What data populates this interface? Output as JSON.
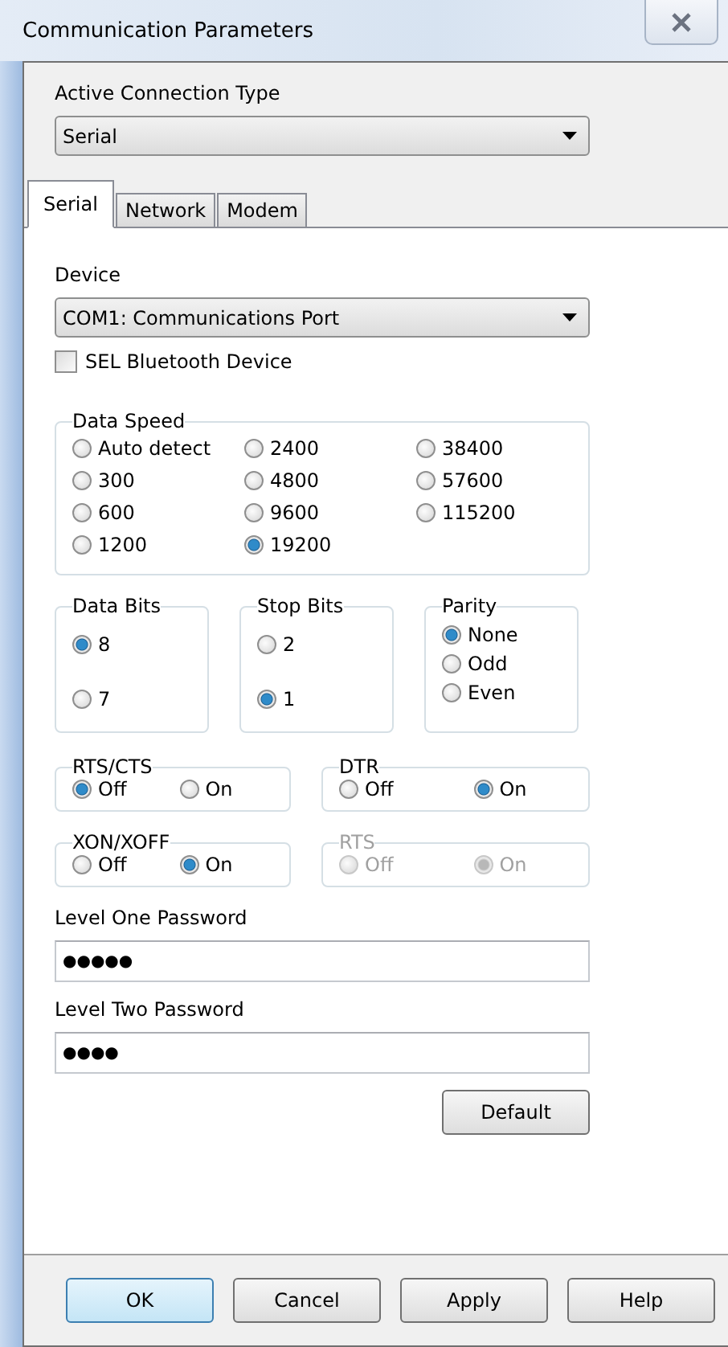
{
  "window": {
    "title": "Communication Parameters"
  },
  "connection": {
    "label": "Active Connection Type",
    "value": "Serial"
  },
  "tabs": [
    {
      "label": "Serial",
      "selected": true
    },
    {
      "label": "Network",
      "selected": false
    },
    {
      "label": "Modem",
      "selected": false
    }
  ],
  "device": {
    "label": "Device",
    "value": "COM1: Communications Port"
  },
  "bluetooth": {
    "label": "SEL Bluetooth Device",
    "checked": false
  },
  "data_speed": {
    "title": "Data Speed",
    "options": [
      {
        "label": "Auto detect",
        "selected": false
      },
      {
        "label": "300",
        "selected": false
      },
      {
        "label": "600",
        "selected": false
      },
      {
        "label": "1200",
        "selected": false
      },
      {
        "label": "2400",
        "selected": false
      },
      {
        "label": "4800",
        "selected": false
      },
      {
        "label": "9600",
        "selected": false
      },
      {
        "label": "19200",
        "selected": true
      },
      {
        "label": "38400",
        "selected": false
      },
      {
        "label": "57600",
        "selected": false
      },
      {
        "label": "115200",
        "selected": false
      }
    ]
  },
  "bit_groups": [
    {
      "title": "Data Bits",
      "options": [
        {
          "label": "8",
          "selected": true
        },
        {
          "label": "7",
          "selected": false
        }
      ]
    },
    {
      "title": "Stop Bits",
      "options": [
        {
          "label": "2",
          "selected": false
        },
        {
          "label": "1",
          "selected": true
        }
      ]
    },
    {
      "title": "Parity",
      "options": [
        {
          "label": "None",
          "selected": true
        },
        {
          "label": "Odd",
          "selected": false
        },
        {
          "label": "Even",
          "selected": false
        }
      ]
    }
  ],
  "flow_groups": [
    {
      "title": "RTS/CTS",
      "disabled": false,
      "options": [
        {
          "label": "Off",
          "selected": true
        },
        {
          "label": "On",
          "selected": false
        }
      ]
    },
    {
      "title": "DTR",
      "disabled": false,
      "options": [
        {
          "label": "Off",
          "selected": false
        },
        {
          "label": "On",
          "selected": true
        }
      ]
    },
    {
      "title": "XON/XOFF",
      "disabled": false,
      "options": [
        {
          "label": "Off",
          "selected": false
        },
        {
          "label": "On",
          "selected": true
        }
      ]
    },
    {
      "title": "RTS",
      "disabled": true,
      "options": [
        {
          "label": "Off",
          "selected": false
        },
        {
          "label": "On",
          "selected": true
        }
      ]
    }
  ],
  "passwords": [
    {
      "label": "Level One Password",
      "value": "●●●●●"
    },
    {
      "label": "Level Two Password",
      "value": "●●●●"
    }
  ],
  "default_button": "Default",
  "buttons": [
    {
      "label": "OK",
      "default": true
    },
    {
      "label": "Cancel",
      "default": false
    },
    {
      "label": "Apply",
      "default": false
    },
    {
      "label": "Help",
      "default": false
    }
  ]
}
